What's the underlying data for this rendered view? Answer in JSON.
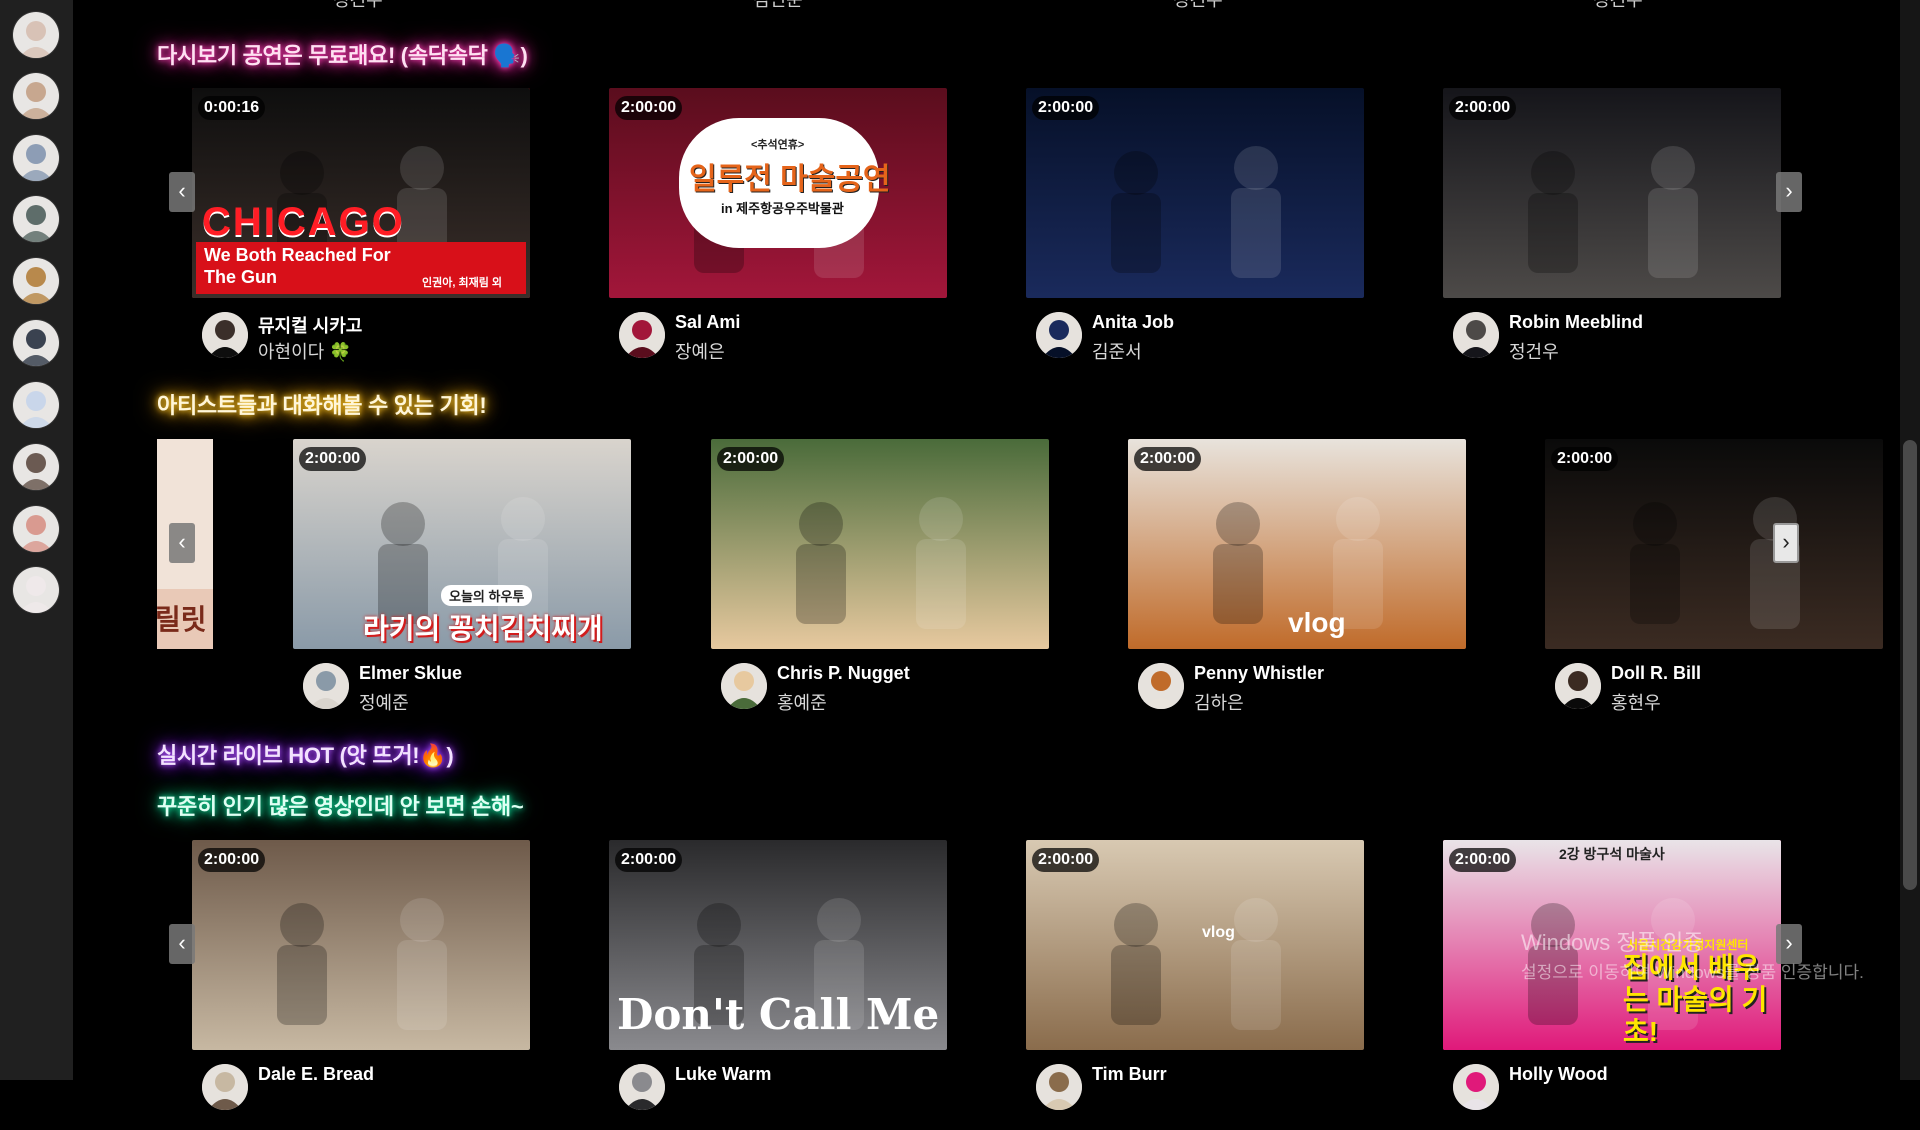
{
  "sidebar": {
    "avatars": [
      {
        "color": "#d8c2b6"
      },
      {
        "color": "#c7a78f"
      },
      {
        "color": "#8d9db5"
      },
      {
        "color": "#5e6d6a"
      },
      {
        "color": "#b8894c"
      },
      {
        "color": "#3a4250"
      },
      {
        "color": "#c9d6ea"
      },
      {
        "color": "#6b5a52"
      },
      {
        "color": "#d99a90"
      },
      {
        "color": "#efe9ea"
      }
    ]
  },
  "top_strip": {
    "partial_names": [
      "정건우",
      "김민준",
      "정건우",
      "정건우"
    ]
  },
  "sections": [
    {
      "title": "다시보기 공연은 무료래요! (속닥속닥 🗣️)",
      "cards": [
        {
          "duration": "0:00:16",
          "overlay_title": "CHICAGO",
          "overlay_sub": "We Both Reached For The Gun",
          "overlay_note": "인권아, 최재림 외",
          "thumb_colors": [
            "#0e0e0e",
            "#3b2f2a"
          ],
          "channel": "뮤지컬 시카고",
          "subtitle": "아현이다 🍀"
        },
        {
          "duration": "2:00:00",
          "overlay_title": "일루전 마술공연",
          "overlay_sub": "in 제주항공우주박물관",
          "overlay_note": "<추석연휴>",
          "thumb_colors": [
            "#5a0d1d",
            "#a2163a"
          ],
          "channel": "Sal Ami",
          "subtitle": "장예은"
        },
        {
          "duration": "2:00:00",
          "thumb_colors": [
            "#061028",
            "#1a2a5c"
          ],
          "channel": "Anita Job",
          "subtitle": "김준서"
        },
        {
          "duration": "2:00:00",
          "thumb_colors": [
            "#15151a",
            "#4d4a48"
          ],
          "channel": "Robin Meeblind",
          "subtitle": "정건우"
        }
      ]
    },
    {
      "title": "아티스트들과 대화해볼 수 있는 기회!",
      "partial_card_text": "릴릿",
      "cards": [
        {
          "duration": "2:00:00",
          "overlay_title": "라키의 꽁치김치찌개",
          "overlay_note": "오늘의 하우투",
          "thumb_colors": [
            "#d9d4cd",
            "#8a9aa8"
          ],
          "channel": "Elmer Sklue",
          "subtitle": "정예준"
        },
        {
          "duration": "2:00:00",
          "thumb_colors": [
            "#4a6b3a",
            "#e7c99f"
          ],
          "channel": "Chris P. Nugget",
          "subtitle": "홍예준"
        },
        {
          "duration": "2:00:00",
          "overlay_title": "vlog",
          "thumb_colors": [
            "#e8e3dc",
            "#c06b2a"
          ],
          "channel": "Penny Whistler",
          "subtitle": "김하은"
        },
        {
          "duration": "2:00:00",
          "thumb_colors": [
            "#0a0a0a",
            "#3b2b22"
          ],
          "channel": "Doll R. Bill",
          "subtitle": "홍현우"
        }
      ]
    },
    {
      "title": "실시간 라이브 HOT (앗 뜨거!🔥)",
      "cards": []
    },
    {
      "title": "꾸준히 인기 많은 영상인데 안 보면 손해~",
      "cards": [
        {
          "duration": "2:00:00",
          "thumb_colors": [
            "#6e5a4a",
            "#c7b8a2"
          ],
          "channel": "Dale E. Bread",
          "subtitle": ""
        },
        {
          "duration": "2:00:00",
          "overlay_title": "Don't Call Me",
          "thumb_colors": [
            "#2a2a2c",
            "#8a8a8e"
          ],
          "channel": "Luke Warm",
          "subtitle": ""
        },
        {
          "duration": "2:00:00",
          "overlay_title": "vlog",
          "thumb_colors": [
            "#d8c9b2",
            "#8a6c4c"
          ],
          "channel": "Tim Burr",
          "subtitle": ""
        },
        {
          "duration": "2:00:00",
          "overlay_title": "집에서 배우는 마술의 기초!",
          "overlay_sub": "2강 방구석 마술사",
          "overlay_note": "서울시건강가정지원센터",
          "thumb_colors": [
            "#e9e4e8",
            "#e0197a"
          ],
          "channel": "Holly Wood",
          "subtitle": ""
        }
      ]
    }
  ],
  "nav": {
    "prev_label": "‹",
    "next_label": "›"
  },
  "watermark": {
    "line1": "Windows 정품 인증",
    "line2": "설정으로 이동하여 Windows를 정품 인증합니다."
  }
}
